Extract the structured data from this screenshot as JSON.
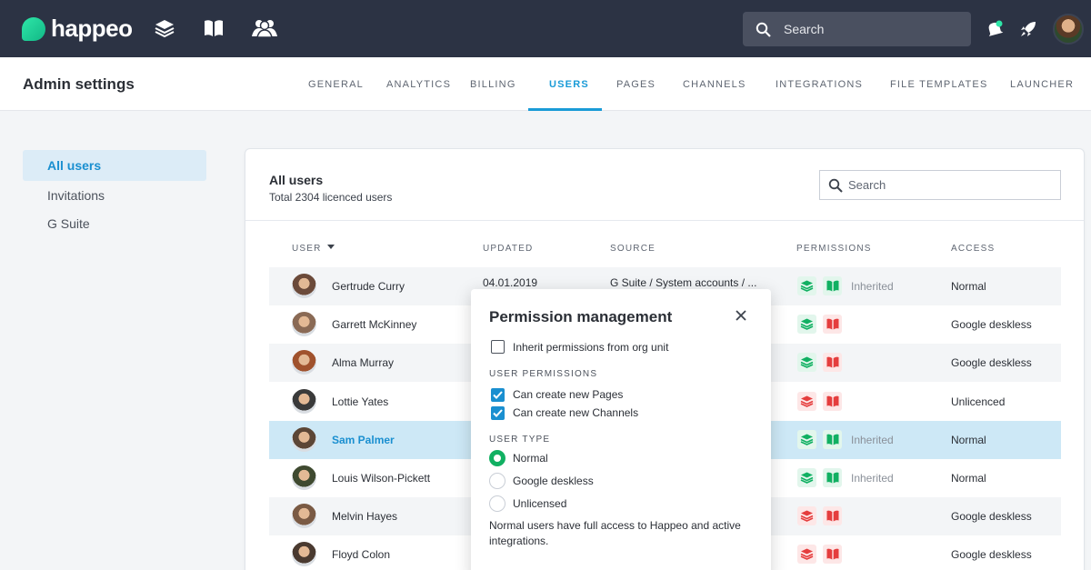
{
  "brand": {
    "name": "happeo"
  },
  "topbar": {
    "search_placeholder": "Search"
  },
  "header": {
    "title": "Admin settings",
    "tabs": [
      {
        "label": "GENERAL"
      },
      {
        "label": "ANALYTICS"
      },
      {
        "label": "BILLING"
      },
      {
        "label": "USERS"
      },
      {
        "label": "PAGES"
      },
      {
        "label": "CHANNELS"
      },
      {
        "label": "INTEGRATIONS"
      },
      {
        "label": "FILE TEMPLATES"
      },
      {
        "label": "LAUNCHER"
      }
    ],
    "active_tab": "USERS"
  },
  "sidebar": {
    "items": [
      {
        "label": "All users"
      },
      {
        "label": "Invitations"
      },
      {
        "label": "G Suite"
      }
    ]
  },
  "panel": {
    "title": "All users",
    "subtitle": "Total 2304 licenced users",
    "search_placeholder": "Search",
    "columns": {
      "user": "USER",
      "updated": "UPDATED",
      "source": "SOURCE",
      "permissions": "PERMISSIONS",
      "access": "ACCESS"
    }
  },
  "users": [
    {
      "name": "Gertrude Curry",
      "updated": "04.01.2019",
      "source": "G Suite / System accounts / ...",
      "pages_perm": "green",
      "channels_perm": "green",
      "inherited": "Inherited",
      "access": "Normal"
    },
    {
      "name": "Garrett McKinney",
      "pages_perm": "green",
      "channels_perm": "red",
      "inherited": "",
      "access": "Google deskless"
    },
    {
      "name": "Alma Murray",
      "pages_perm": "green",
      "channels_perm": "red",
      "inherited": "",
      "access": "Google deskless"
    },
    {
      "name": "Lottie Yates",
      "pages_perm": "red",
      "channels_perm": "red",
      "inherited": "",
      "access": "Unlicenced"
    },
    {
      "name": "Sam Palmer",
      "pages_perm": "green",
      "channels_perm": "green",
      "inherited": "Inherited",
      "access": "Normal"
    },
    {
      "name": "Louis Wilson-Pickett",
      "pages_perm": "green",
      "channels_perm": "green",
      "inherited": "Inherited",
      "access": "Normal"
    },
    {
      "name": "Melvin Hayes",
      "pages_perm": "red",
      "channels_perm": "red",
      "inherited": "",
      "access": "Google deskless"
    },
    {
      "name": "Floyd Colon",
      "pages_perm": "red",
      "channels_perm": "red",
      "inherited": "",
      "access": "Google deskless"
    }
  ],
  "selected_user": "Sam Palmer",
  "modal": {
    "title": "Permission management",
    "inherit_label": "Inherit permissions from org unit",
    "inherit_checked": false,
    "user_permissions_heading": "USER PERMISSIONS",
    "permissions": [
      {
        "label": "Can create new Pages",
        "checked": true
      },
      {
        "label": "Can create new Channels",
        "checked": true
      }
    ],
    "user_type_heading": "USER TYPE",
    "user_types": [
      {
        "label": "Normal",
        "selected": true
      },
      {
        "label": "Google deskless",
        "selected": false
      },
      {
        "label": "Unlicensed",
        "selected": false
      }
    ],
    "description": "Normal users have full access to Happeo and active integrations."
  },
  "colors": {
    "accent": "#1a9bd7",
    "topbar": "#2c3344",
    "green": "#11b062",
    "red": "#e53e3e",
    "selected_row": "#cde8f6"
  }
}
